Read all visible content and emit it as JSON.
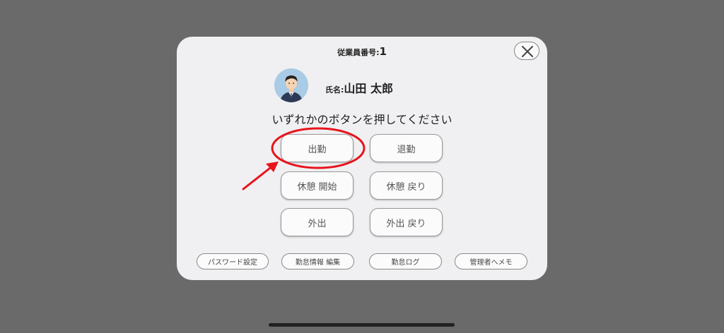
{
  "dialog": {
    "employee_number_label": "従業員番号:",
    "employee_number": "1",
    "name_label": "氏名:",
    "name": "山田 太郎",
    "instruction": "いずれかのボタンを押してください"
  },
  "actions": {
    "clock_in": "出勤",
    "clock_out": "退勤",
    "break_start": "休憩 開始",
    "break_end": "休憩 戻り",
    "go_out": "外出",
    "return_from_out": "外出 戻り"
  },
  "footer": {
    "password_settings": "パスワード設定",
    "edit_attendance": "勤怠情報 編集",
    "attendance_log": "勤怠ログ",
    "memo_to_admin": "管理者へメモ"
  },
  "colors": {
    "backdrop": "#6a6a6a",
    "dialog_bg": "#f0f0f2",
    "annotation_red": "#e8141b"
  },
  "icons": {
    "close": "close-icon",
    "avatar": "person-avatar-icon"
  }
}
